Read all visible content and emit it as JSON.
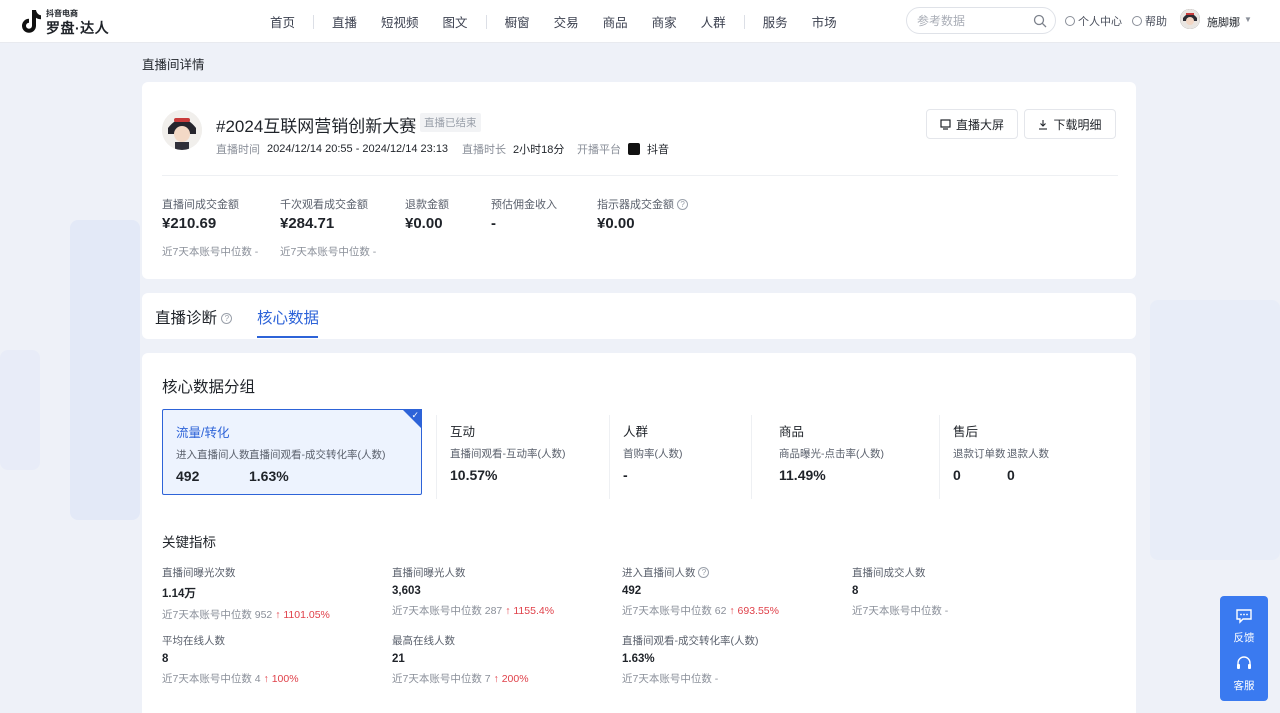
{
  "app": {
    "logo_small": "抖音电商",
    "logo_big": "罗盘·达人"
  },
  "nav": {
    "items": [
      "首页",
      "直播",
      "短视频",
      "图文",
      "橱窗",
      "交易",
      "商品",
      "商家",
      "人群",
      "服务",
      "市场"
    ]
  },
  "search": {
    "placeholder": "参考数据"
  },
  "top_links": {
    "personal": "个人中心",
    "help": "帮助",
    "username": "施脚娜"
  },
  "breadcrumb": "直播间详情",
  "live": {
    "title": "#2024互联网营销创新大赛",
    "status": "直播已结束",
    "time_label": "直播时间",
    "time_value": "2024/12/14 20:55 - 2024/12/14 23:13",
    "duration_label": "直播时长",
    "duration_value": "2小时18分",
    "platform_label": "开播平台",
    "platform_value": "抖音"
  },
  "buttons": {
    "big_screen": "直播大屏",
    "download": "下载明细"
  },
  "summary_metrics": [
    {
      "label": "直播间成交金额",
      "value": "¥210.69",
      "sub": "近7天本账号中位数 -"
    },
    {
      "label": "千次观看成交金额",
      "value": "¥284.71",
      "sub": "近7天本账号中位数 -"
    },
    {
      "label": "退款金额",
      "value": "¥0.00",
      "sub": ""
    },
    {
      "label": "预估佣金收入",
      "value": "-",
      "sub": ""
    },
    {
      "label": "指示器成交金额",
      "value": "¥0.00",
      "sub": ""
    }
  ],
  "tabs": {
    "diagnosis": "直播诊断",
    "core": "核心数据"
  },
  "section_title": "核心数据分组",
  "groups": [
    {
      "name": "流量/转化",
      "metrics": [
        {
          "label": "进入直播间人数",
          "value": "492"
        },
        {
          "label": "直播间观看-成交转化率(人数)",
          "value": "1.63%"
        }
      ]
    },
    {
      "name": "互动",
      "metrics": [
        {
          "label": "直播间观看-互动率(人数)",
          "value": "10.57%"
        }
      ]
    },
    {
      "name": "人群",
      "metrics": [
        {
          "label": "首购率(人数)",
          "value": "-"
        }
      ]
    },
    {
      "name": "商品",
      "metrics": [
        {
          "label": "商品曝光-点击率(人数)",
          "value": "11.49%"
        }
      ]
    },
    {
      "name": "售后",
      "metrics": [
        {
          "label": "退款订单数",
          "value": "0"
        },
        {
          "label": "退款人数",
          "value": "0"
        }
      ]
    }
  ],
  "kpi_title": "关键指标",
  "kpis": [
    {
      "label": "直播间曝光次数",
      "value": "1.14万",
      "median": "近7天本账号中位数 952",
      "change": "↑ 1101.05%"
    },
    {
      "label": "直播间曝光人数",
      "value": "3,603",
      "median": "近7天本账号中位数 287",
      "change": "↑ 1155.4%"
    },
    {
      "label": "进入直播间人数",
      "value": "492",
      "median": "近7天本账号中位数 62",
      "change": "↑ 693.55%"
    },
    {
      "label": "直播间成交人数",
      "value": "8",
      "median": "近7天本账号中位数 -",
      "change": ""
    },
    {
      "label": "平均在线人数",
      "value": "8",
      "median": "近7天本账号中位数 4",
      "change": "↑ 100%"
    },
    {
      "label": "最高在线人数",
      "value": "21",
      "median": "近7天本账号中位数 7",
      "change": "↑ 200%"
    },
    {
      "label": "直播间观看-成交转化率(人数)",
      "value": "1.63%",
      "median": "近7天本账号中位数 -",
      "change": ""
    }
  ],
  "float": {
    "feedback": "反馈",
    "service": "客服"
  },
  "colors": {
    "accent": "#2d63d8",
    "up": "#e0414a",
    "float_bg": "#3a7af0"
  }
}
